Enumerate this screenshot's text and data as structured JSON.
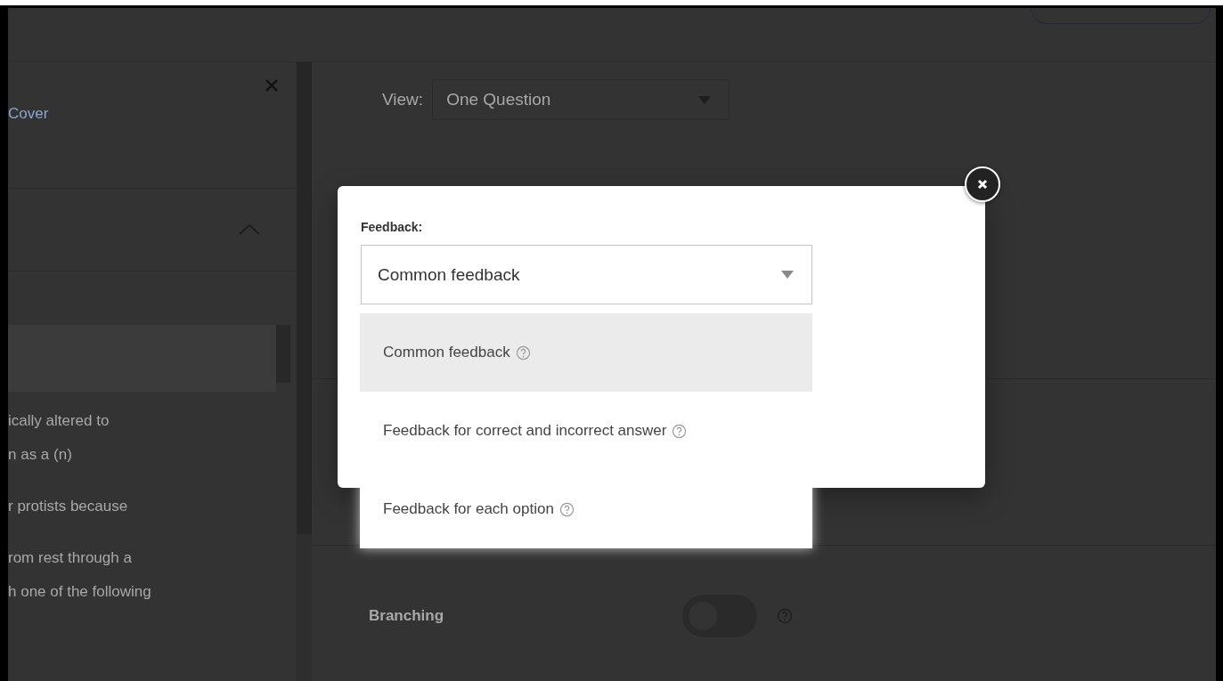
{
  "sidebar": {
    "cover_link": "Cover",
    "questions": [
      {
        "lines": [
          "ically altered to",
          "n as a (n)"
        ]
      },
      {
        "lines": [
          "r protists because"
        ]
      },
      {
        "lines": [
          "rom rest through a",
          "h one of the following"
        ]
      }
    ]
  },
  "view": {
    "label": "View:",
    "value": "One Question"
  },
  "settings": [
    {
      "label": "Branching",
      "on": false
    }
  ],
  "dialog": {
    "field_label": "Feedback:",
    "value": "Common feedback",
    "options": [
      {
        "label": "Common feedback",
        "selected": true
      },
      {
        "label": "Feedback for correct and incorrect answer",
        "selected": false
      },
      {
        "label": "Feedback for each option",
        "selected": false
      }
    ]
  }
}
